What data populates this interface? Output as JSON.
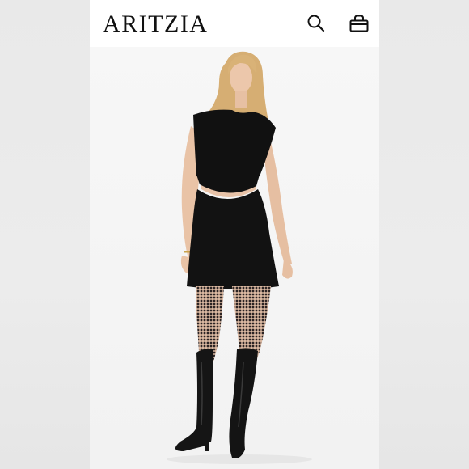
{
  "header": {
    "brand": "ARITZIA",
    "search_icon": "search-icon",
    "bag_icon": "shopping-bag-icon"
  },
  "product_image": {
    "subject": "model-in-black-cutout-mini-dress",
    "colors": {
      "dress": "#111111",
      "skin": "#e8c3a8",
      "hair": "#d8b27a",
      "tights": "#2a2424",
      "boots": "#141414",
      "background": "#f4f4f4"
    }
  }
}
